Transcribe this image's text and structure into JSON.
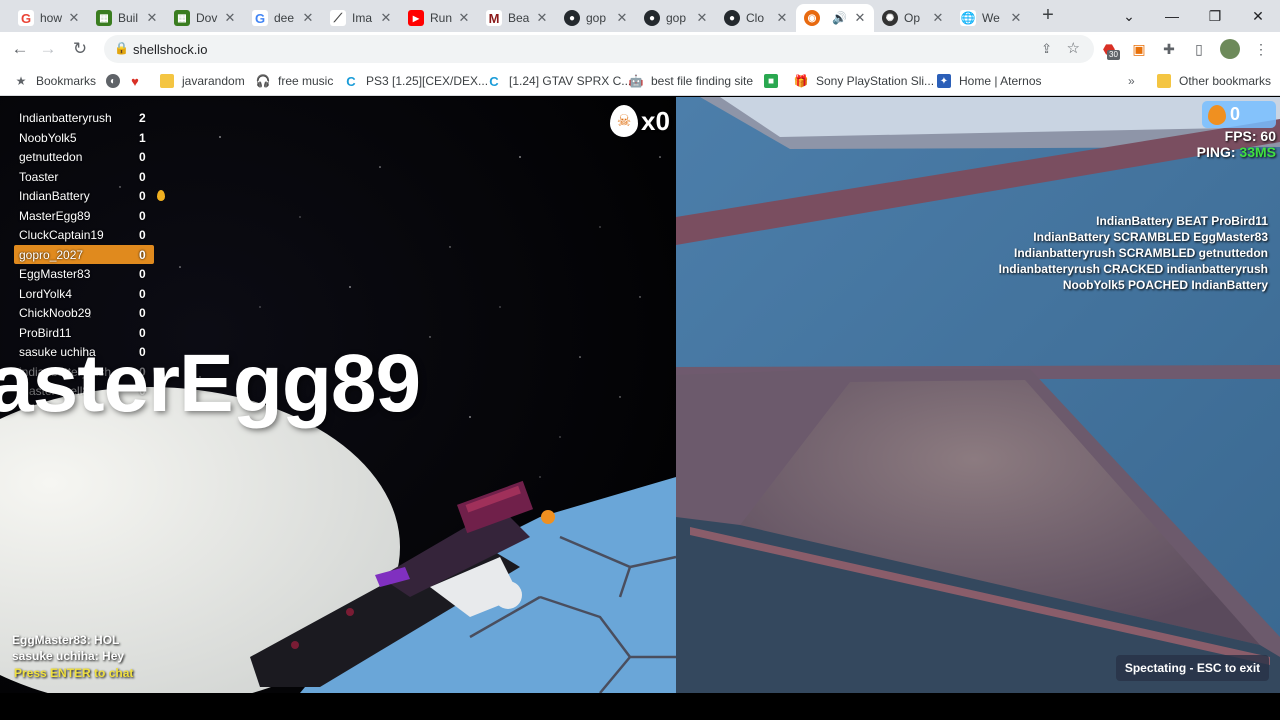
{
  "browser": {
    "tabs": [
      {
        "title": "how",
        "icon": "google-icon",
        "color": "#ea4335"
      },
      {
        "title": "Buil",
        "icon": "minecraft-icon",
        "color": "#3a7d20"
      },
      {
        "title": "Dov",
        "icon": "minecraft-icon",
        "color": "#3a7d20"
      },
      {
        "title": "dee",
        "icon": "google-icon",
        "color": "#4285f4"
      },
      {
        "title": "Ima",
        "icon": "chart-icon",
        "color": "#4a4a4a"
      },
      {
        "title": "Run",
        "icon": "youtube-icon",
        "color": "#ff0000"
      },
      {
        "title": "Bea",
        "icon": "m-icon",
        "color": "#8b1a1a"
      },
      {
        "title": "gop",
        "icon": "github-icon",
        "color": "#24292e"
      },
      {
        "title": "gop",
        "icon": "github-icon",
        "color": "#24292e"
      },
      {
        "title": "Clo",
        "icon": "github-icon",
        "color": "#24292e"
      },
      {
        "title": "",
        "icon": "shellshock-icon",
        "color": "#e86a10"
      },
      {
        "title": "Op",
        "icon": "openai-icon",
        "color": "#333333"
      },
      {
        "title": "We",
        "icon": "globe-icon",
        "color": "#5f6368"
      }
    ],
    "url": "shellshock.io",
    "extension_badge": "30",
    "bookmarks": [
      {
        "label": "Bookmarks",
        "icon": "star-icon"
      },
      {
        "label": "",
        "icon": "web-icon"
      },
      {
        "label": "",
        "icon": "heart-icon"
      },
      {
        "label": "javarandom",
        "icon": "folder-icon"
      },
      {
        "label": "free music",
        "icon": "headphones-icon"
      },
      {
        "label": "PS3 [1.25][CEX/DEX...",
        "icon": "c-icon"
      },
      {
        "label": "[1.24] GTAV SPRX C...",
        "icon": "c-icon"
      },
      {
        "label": "best file finding site",
        "icon": "robot-icon"
      },
      {
        "label": "",
        "icon": "green-app-icon"
      },
      {
        "label": "Sony PlayStation Sli...",
        "icon": "gift-icon"
      },
      {
        "label": "Home | Aternos",
        "icon": "aternos-icon"
      }
    ],
    "other_bookmarks": "Other bookmarks"
  },
  "game": {
    "scoreboard": [
      {
        "name": "Indianbatteryrush",
        "score": "2"
      },
      {
        "name": "NoobYolk5",
        "score": "1"
      },
      {
        "name": "getnuttedon",
        "score": "0"
      },
      {
        "name": "Toaster",
        "score": "0"
      },
      {
        "name": "IndianBattery",
        "score": "0"
      },
      {
        "name": "MasterEgg89",
        "score": "0"
      },
      {
        "name": "CluckCaptain19",
        "score": "0"
      },
      {
        "name": "gopro_2027",
        "score": "0"
      },
      {
        "name": "EggMaster83",
        "score": "0"
      },
      {
        "name": "LordYolk4",
        "score": "0"
      },
      {
        "name": "ChickNoob29",
        "score": "0"
      },
      {
        "name": "ProBird11",
        "score": "0"
      },
      {
        "name": "sasuke uchiha",
        "score": "0"
      },
      {
        "name": "indianbatteryrush",
        "score": "0"
      },
      {
        "name": "MasterShell8",
        "score": "0"
      }
    ],
    "player_label": "asterEgg89",
    "kill_streak": "x0",
    "egg_balance": "0",
    "fps_label": "FPS:",
    "fps": "60",
    "ping_label": "PING:",
    "ping": "33MS",
    "killfeed": [
      "IndianBattery BEAT ProBird11",
      "IndianBattery SCRAMBLED EggMaster83",
      "Indianbatteryrush SCRAMBLED getnuttedon",
      "Indianbatteryrush CRACKED indianbatteryrush",
      "NoobYolk5 POACHED IndianBattery"
    ],
    "chat": [
      "EggMaster83: HOL",
      "sasuke uchiha: Hey"
    ],
    "chat_prompt": "Press ENTER to chat",
    "spectate": "Spectating - ESC to exit"
  }
}
